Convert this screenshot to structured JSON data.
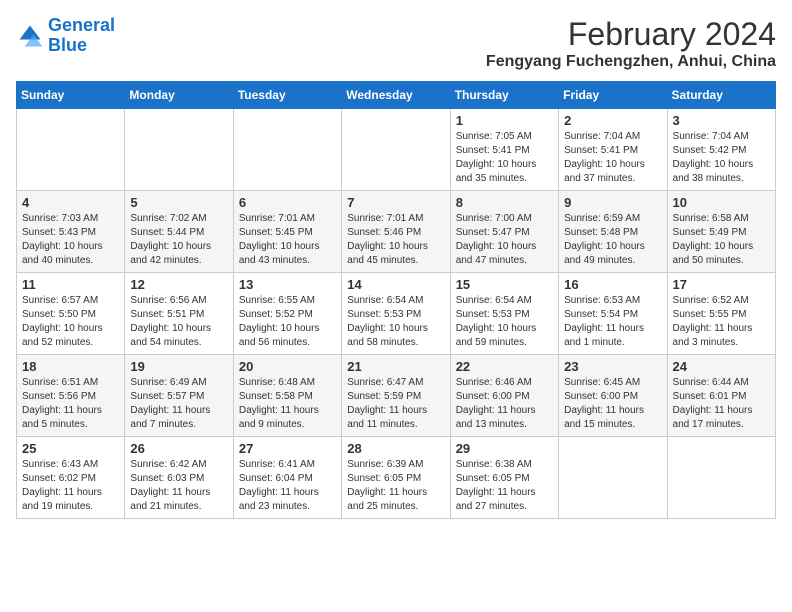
{
  "logo": {
    "line1": "General",
    "line2": "Blue"
  },
  "title": "February 2024",
  "location": "Fengyang Fuchengzhen, Anhui, China",
  "days_of_week": [
    "Sunday",
    "Monday",
    "Tuesday",
    "Wednesday",
    "Thursday",
    "Friday",
    "Saturday"
  ],
  "weeks": [
    [
      {
        "num": "",
        "info": ""
      },
      {
        "num": "",
        "info": ""
      },
      {
        "num": "",
        "info": ""
      },
      {
        "num": "",
        "info": ""
      },
      {
        "num": "1",
        "info": "Sunrise: 7:05 AM\nSunset: 5:41 PM\nDaylight: 10 hours\nand 35 minutes."
      },
      {
        "num": "2",
        "info": "Sunrise: 7:04 AM\nSunset: 5:41 PM\nDaylight: 10 hours\nand 37 minutes."
      },
      {
        "num": "3",
        "info": "Sunrise: 7:04 AM\nSunset: 5:42 PM\nDaylight: 10 hours\nand 38 minutes."
      }
    ],
    [
      {
        "num": "4",
        "info": "Sunrise: 7:03 AM\nSunset: 5:43 PM\nDaylight: 10 hours\nand 40 minutes."
      },
      {
        "num": "5",
        "info": "Sunrise: 7:02 AM\nSunset: 5:44 PM\nDaylight: 10 hours\nand 42 minutes."
      },
      {
        "num": "6",
        "info": "Sunrise: 7:01 AM\nSunset: 5:45 PM\nDaylight: 10 hours\nand 43 minutes."
      },
      {
        "num": "7",
        "info": "Sunrise: 7:01 AM\nSunset: 5:46 PM\nDaylight: 10 hours\nand 45 minutes."
      },
      {
        "num": "8",
        "info": "Sunrise: 7:00 AM\nSunset: 5:47 PM\nDaylight: 10 hours\nand 47 minutes."
      },
      {
        "num": "9",
        "info": "Sunrise: 6:59 AM\nSunset: 5:48 PM\nDaylight: 10 hours\nand 49 minutes."
      },
      {
        "num": "10",
        "info": "Sunrise: 6:58 AM\nSunset: 5:49 PM\nDaylight: 10 hours\nand 50 minutes."
      }
    ],
    [
      {
        "num": "11",
        "info": "Sunrise: 6:57 AM\nSunset: 5:50 PM\nDaylight: 10 hours\nand 52 minutes."
      },
      {
        "num": "12",
        "info": "Sunrise: 6:56 AM\nSunset: 5:51 PM\nDaylight: 10 hours\nand 54 minutes."
      },
      {
        "num": "13",
        "info": "Sunrise: 6:55 AM\nSunset: 5:52 PM\nDaylight: 10 hours\nand 56 minutes."
      },
      {
        "num": "14",
        "info": "Sunrise: 6:54 AM\nSunset: 5:53 PM\nDaylight: 10 hours\nand 58 minutes."
      },
      {
        "num": "15",
        "info": "Sunrise: 6:54 AM\nSunset: 5:53 PM\nDaylight: 10 hours\nand 59 minutes."
      },
      {
        "num": "16",
        "info": "Sunrise: 6:53 AM\nSunset: 5:54 PM\nDaylight: 11 hours\nand 1 minute."
      },
      {
        "num": "17",
        "info": "Sunrise: 6:52 AM\nSunset: 5:55 PM\nDaylight: 11 hours\nand 3 minutes."
      }
    ],
    [
      {
        "num": "18",
        "info": "Sunrise: 6:51 AM\nSunset: 5:56 PM\nDaylight: 11 hours\nand 5 minutes."
      },
      {
        "num": "19",
        "info": "Sunrise: 6:49 AM\nSunset: 5:57 PM\nDaylight: 11 hours\nand 7 minutes."
      },
      {
        "num": "20",
        "info": "Sunrise: 6:48 AM\nSunset: 5:58 PM\nDaylight: 11 hours\nand 9 minutes."
      },
      {
        "num": "21",
        "info": "Sunrise: 6:47 AM\nSunset: 5:59 PM\nDaylight: 11 hours\nand 11 minutes."
      },
      {
        "num": "22",
        "info": "Sunrise: 6:46 AM\nSunset: 6:00 PM\nDaylight: 11 hours\nand 13 minutes."
      },
      {
        "num": "23",
        "info": "Sunrise: 6:45 AM\nSunset: 6:00 PM\nDaylight: 11 hours\nand 15 minutes."
      },
      {
        "num": "24",
        "info": "Sunrise: 6:44 AM\nSunset: 6:01 PM\nDaylight: 11 hours\nand 17 minutes."
      }
    ],
    [
      {
        "num": "25",
        "info": "Sunrise: 6:43 AM\nSunset: 6:02 PM\nDaylight: 11 hours\nand 19 minutes."
      },
      {
        "num": "26",
        "info": "Sunrise: 6:42 AM\nSunset: 6:03 PM\nDaylight: 11 hours\nand 21 minutes."
      },
      {
        "num": "27",
        "info": "Sunrise: 6:41 AM\nSunset: 6:04 PM\nDaylight: 11 hours\nand 23 minutes."
      },
      {
        "num": "28",
        "info": "Sunrise: 6:39 AM\nSunset: 6:05 PM\nDaylight: 11 hours\nand 25 minutes."
      },
      {
        "num": "29",
        "info": "Sunrise: 6:38 AM\nSunset: 6:05 PM\nDaylight: 11 hours\nand 27 minutes."
      },
      {
        "num": "",
        "info": ""
      },
      {
        "num": "",
        "info": ""
      }
    ]
  ]
}
